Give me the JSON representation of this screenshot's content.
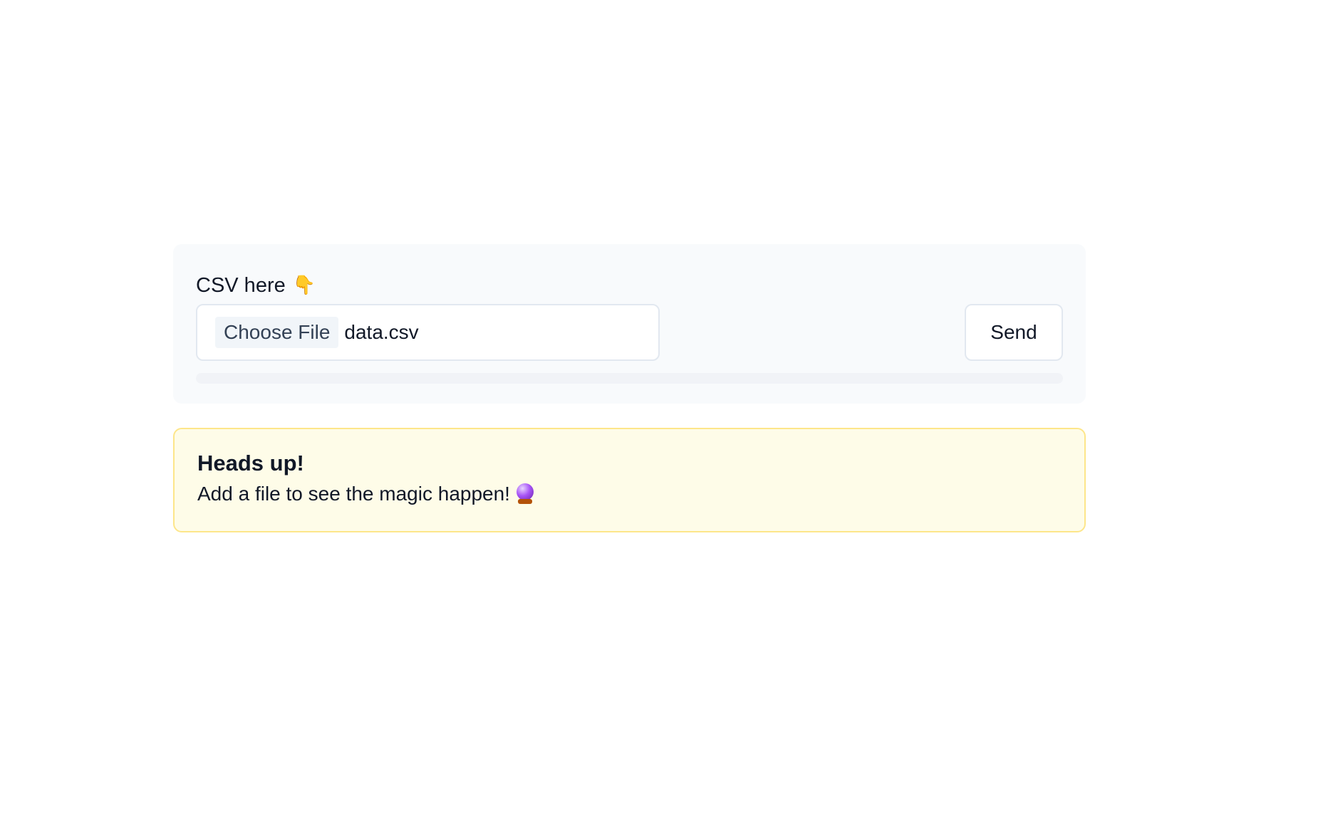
{
  "upload": {
    "label": "CSV here",
    "label_emoji": "👇",
    "choose_file_label": "Choose File",
    "file_name": "data.csv",
    "send_label": "Send",
    "progress_percent": 0
  },
  "alert": {
    "title": "Heads up!",
    "message": "Add a file to see the magic happen!",
    "icon": "crystal-ball-icon"
  }
}
